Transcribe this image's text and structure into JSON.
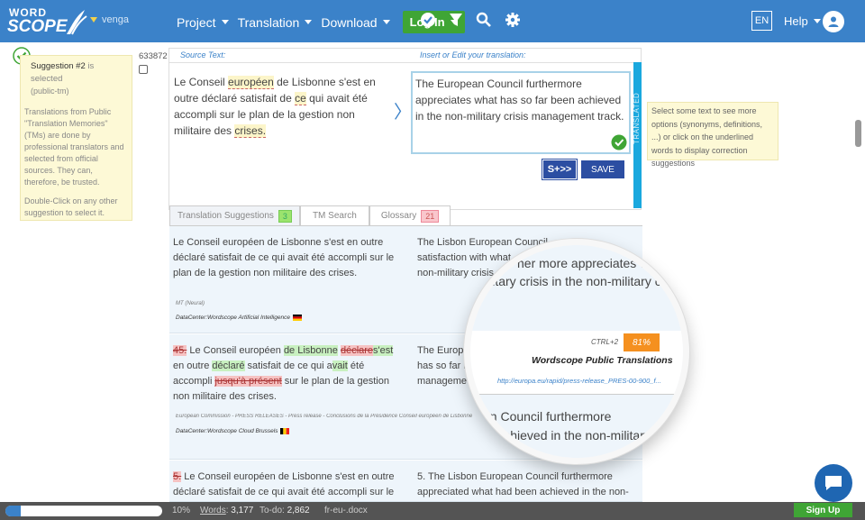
{
  "app": {
    "logo_line1": "WORD",
    "logo_line2": "SCOPE",
    "user": "venga"
  },
  "nav": {
    "project": "Project",
    "translation": "Translation",
    "download": "Download",
    "login": "Log In",
    "language": "EN",
    "help": "Help"
  },
  "info_panel": {
    "title": "Suggestion #2",
    "title_suffix": "is selected",
    "subtitle": "(public-tm)",
    "para1": "Translations from Public \"Translation Memories\" (TMs) are done by professional translators and selected from official sources. They can, therefore, be trusted.",
    "para2": "Double-Click on any other suggestion to select it."
  },
  "segment": {
    "number": "633872",
    "source_label": "Source Text:",
    "target_label": "Insert or Edit your translation:",
    "source_parts": [
      "Le Conseil ",
      "européen",
      " de Lisbonne s'est en outre déclaré satisfait de ",
      "ce",
      " qui avait été accompli sur le plan de la gestion non militaire des ",
      "crises."
    ],
    "target_text": "The European Council furthermore appreciates what has so far been achieved in the non-military crisis management track.",
    "status": "TRANSLATED",
    "splus_label": "S+>>",
    "save_label": "SAVE"
  },
  "hint": {
    "text": "Select some text to see more options (synonyms, definitions, ...) or click on the underlined words to display correction suggestions"
  },
  "tabs": {
    "suggestions": "Translation Suggestions",
    "suggestions_count": "3",
    "tm_search": "TM Search",
    "glossary": "Glossary",
    "glossary_count": "21"
  },
  "suggestions": [
    {
      "source": "Le Conseil européen de Lisbonne s'est en outre déclaré satisfait de ce qui avait été accompli sur le plan de la gestion non militaire des crises.",
      "target": "The Lisbon European Council furthermore appreciates what has achieved in the non-military crisis",
      "target_visible": "The Lisbon European Council",
      "target_visible2": "satisfaction with what",
      "target_visible3": "non-military crisis",
      "meta": "MT (Neural)",
      "datacenter": "DataCenter:Wordscope Artificial Intelligence"
    },
    {
      "num_del": "45.",
      "p1": " Le Conseil européen ",
      "p2": "de Lis",
      "p3": "bonne",
      "p4": " ",
      "p5": "déclare",
      "p6": "s'est",
      "p7": " en outre ",
      "p8": "déclaré",
      "p9": " satisfait de ce qui a",
      "p10": "vait",
      "p11": " été accompli ",
      "p12": "jusqu'à présent",
      "p13": " sur le plan de la gestion non militaire des crises.",
      "target_a": "The Europ",
      "target_b": "has so far b",
      "target_c": "manageme",
      "meta": "European Commission - PRESS RELEASES - Press release - Conclusions de la Présidence Conseil européen de Lisbonne 23",
      "datacenter": "DataCenter:Wordscope Cloud Brussels"
    },
    {
      "num_del": "5.",
      "source": " Le Conseil européen de Lisbonne s'est en outre déclaré satisfait de ce qui avait été accompli sur le plan",
      "target": "5. The Lisbon European Council furthermore appreciated what had been achieved in the non-military"
    }
  ],
  "magnifier": {
    "line1": "ner more appreciates wh",
    "line2": "ilitary crisis in the non-military crisis",
    "shortcut": "CTRL+2",
    "match": "81%",
    "source_name": "Wordscope Public Translations",
    "url": "http://europa.eu/rapid/press-release_PRES-00-900_f...",
    "line3": "an Council furthermore",
    "line4": "en achieved in the non-military"
  },
  "status_bar": {
    "progress_pct": 10,
    "progress_label": "10%",
    "words_label": "Words",
    "words_value": "3,177",
    "todo_label": "To-do:",
    "todo_value": "2,862",
    "file": "fr-eu-.docx",
    "signup": "Sign Up"
  },
  "colors": {
    "brand": "#3b82c9",
    "login_green": "#3fa535",
    "translated_blue": "#1aa8de",
    "match_orange": "#f5901f"
  }
}
